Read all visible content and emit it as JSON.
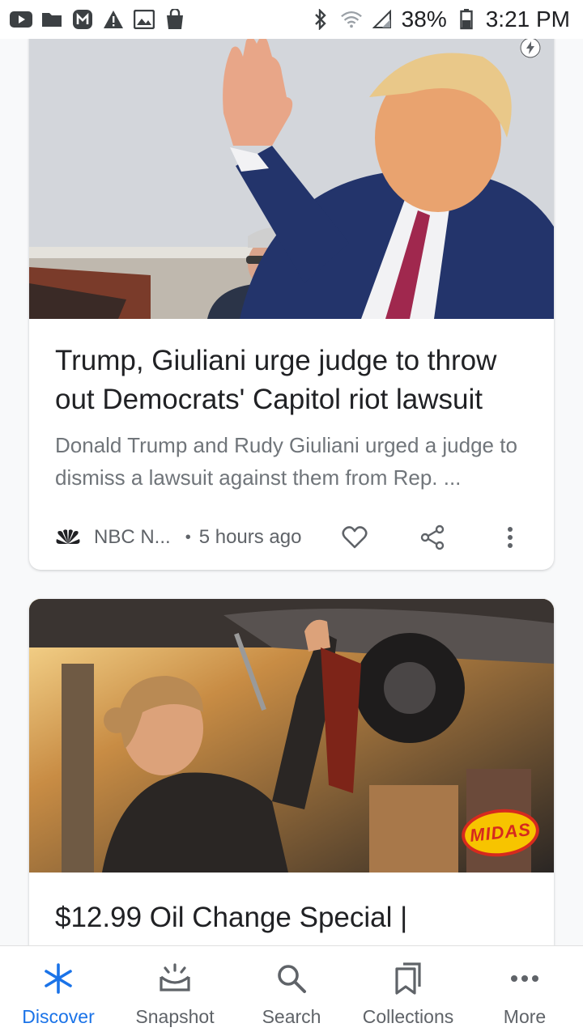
{
  "status_bar": {
    "left_icons": [
      "youtube-icon",
      "folder-icon",
      "m-app-icon",
      "warning-icon",
      "image-icon",
      "shopping-bag-icon"
    ],
    "right_icons": [
      "bluetooth-icon",
      "wifi-icon",
      "signal-icon",
      "battery-icon"
    ],
    "battery": "38%",
    "time": "3:21 PM"
  },
  "feed": {
    "article": {
      "headline": "Trump, Giuliani urge judge to throw out Democrats' Capitol riot lawsuit",
      "snippet": "Donald Trump and Rudy Giuliani urged a judge to dismiss a lawsuit against them from Rep. ...",
      "source": "NBC N...",
      "source_logo": "nbc-peacock-icon",
      "separator": "•",
      "time": "5 hours ago",
      "badge": "amp-lightning-icon"
    },
    "ad": {
      "headline": "$12.99 Oil Change Special |",
      "brand_badge": "MIDAS"
    }
  },
  "bottom_nav": {
    "items": [
      {
        "label": "Discover",
        "icon": "asterisk-icon",
        "active": true
      },
      {
        "label": "Snapshot",
        "icon": "snapshot-icon",
        "active": false
      },
      {
        "label": "Search",
        "icon": "search-icon",
        "active": false
      },
      {
        "label": "Collections",
        "icon": "collections-icon",
        "active": false
      },
      {
        "label": "More",
        "icon": "more-horizontal-icon",
        "active": false
      }
    ]
  },
  "colors": {
    "accent": "#1a73e8",
    "text_primary": "#202124",
    "text_secondary": "#70757a"
  }
}
